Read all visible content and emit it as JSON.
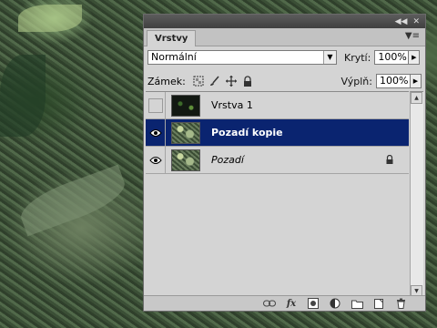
{
  "panel": {
    "tab_label": "Vrstvy",
    "titlebar_icons": [
      "collapse-icon",
      "close-icon"
    ],
    "menu_icon": "panel-menu-icon"
  },
  "blend_mode": {
    "value": "Normální"
  },
  "opacity": {
    "label": "Krytí:",
    "value": "100%"
  },
  "lock": {
    "label": "Zámek:",
    "icons": [
      "lock-transparent-icon",
      "lock-brush-icon",
      "lock-move-icon",
      "lock-all-icon"
    ]
  },
  "fill": {
    "label": "Výplň:",
    "value": "100%"
  },
  "layers": [
    {
      "name": "Vrstva 1",
      "visible": false,
      "selected": false,
      "locked": false
    },
    {
      "name": "Pozadí kopie",
      "visible": true,
      "selected": true,
      "locked": false
    },
    {
      "name": "Pozadí",
      "visible": true,
      "selected": false,
      "locked": true
    }
  ],
  "bottom_icons": [
    "link-icon",
    "fx-icon",
    "mask-icon",
    "adjustment-icon",
    "group-folder-icon",
    "new-layer-icon",
    "trash-icon"
  ],
  "colors": {
    "selected_row": "#0a2470",
    "panel_bg": "#d4d4d4"
  }
}
